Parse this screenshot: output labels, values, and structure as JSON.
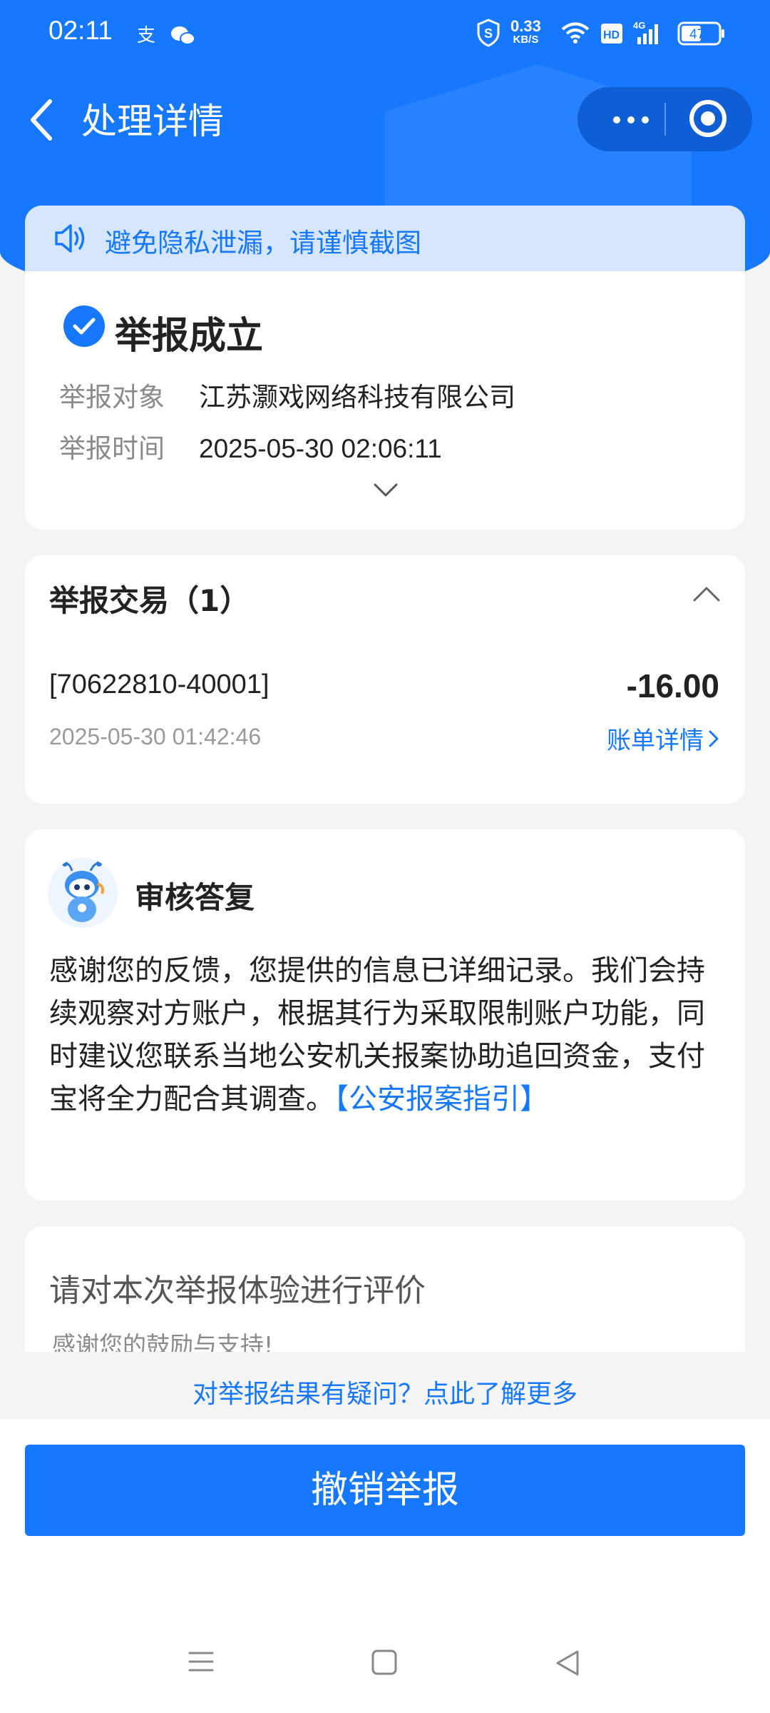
{
  "status_bar": {
    "time": "02:11",
    "net_speed_value": "0.33",
    "net_speed_unit": "KB/S",
    "battery": "47",
    "signal": "4G",
    "hd": "HD"
  },
  "header": {
    "title": "处理详情"
  },
  "notice": {
    "text": "避免隐私泄漏，请谨慎截图"
  },
  "result": {
    "status": "举报成立",
    "target_label": "举报对象",
    "target_value": "江苏灏戏网络科技有限公司",
    "time_label": "举报时间",
    "time_value": "2025-05-30 02:06:11"
  },
  "transactions": {
    "title": "举报交易（1）",
    "items": [
      {
        "id": "[70622810-40001]",
        "time": "2025-05-30 01:42:46",
        "amount": "-16.00",
        "link": "账单详情"
      }
    ]
  },
  "reply": {
    "title": "审核答复",
    "body": "感谢您的反馈，您提供的信息已详细记录。我们会持续观察对方账户，根据其行为采取限制账户功能，同时建议您联系当地公安机关报案协助追回资金，支付宝将全力配合其调查。",
    "link": "【公安报案指引】"
  },
  "rating": {
    "title": "请对本次举报体验进行评价",
    "subtitle": "感谢您的鼓励与支持!"
  },
  "footer": {
    "faq_link": "对举报结果有疑问？点此了解更多",
    "cancel_button": "撤销举报"
  },
  "colors": {
    "brand_blue": "#1677ff",
    "notice_bg": "#d6e6ff",
    "page_bg": "#f4f4f4"
  }
}
